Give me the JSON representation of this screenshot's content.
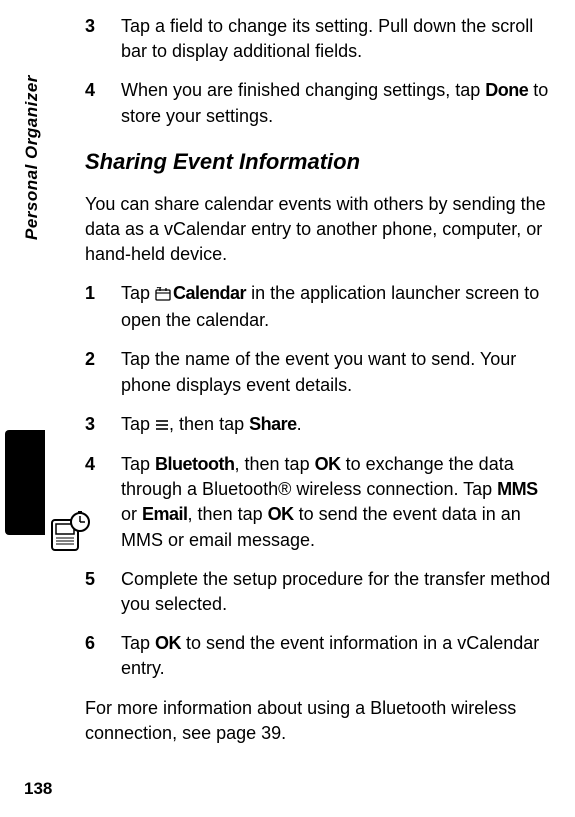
{
  "sidebar": {
    "label": "Personal Organizer"
  },
  "top_steps": [
    {
      "num": "3",
      "parts": [
        {
          "t": "Tap a field to change its setting. Pull down the scroll bar to display additional fields."
        }
      ]
    },
    {
      "num": "4",
      "parts": [
        {
          "t": "When you are finished changing settings, tap "
        },
        {
          "ui": "Done"
        },
        {
          "t": " to store your settings."
        }
      ]
    }
  ],
  "section_heading": "Sharing Event Information",
  "intro": "You can share calendar events with others by sending the data as a vCalendar entry to another phone, computer, or hand-held device.",
  "main_steps": [
    {
      "num": "1",
      "parts": [
        {
          "t": "Tap "
        },
        {
          "calicon": true
        },
        {
          "ui": "Calendar"
        },
        {
          "t": " in the application launcher screen to open the calendar."
        }
      ]
    },
    {
      "num": "2",
      "parts": [
        {
          "t": "Tap the name of the event you want to send. Your phone displays event details."
        }
      ]
    },
    {
      "num": "3",
      "parts": [
        {
          "t": "Tap "
        },
        {
          "menuicon": true
        },
        {
          "t": ", then tap "
        },
        {
          "ui": "Share"
        },
        {
          "t": "."
        }
      ]
    },
    {
      "num": "4",
      "parts": [
        {
          "t": "Tap "
        },
        {
          "ui": "Bluetooth"
        },
        {
          "t": ", then tap "
        },
        {
          "ui": "OK"
        },
        {
          "t": " to exchange the data through a Bluetooth® wireless connection. Tap "
        },
        {
          "ui": "MMS"
        },
        {
          "t": " or "
        },
        {
          "ui": "Email"
        },
        {
          "t": ", then tap "
        },
        {
          "ui": "OK"
        },
        {
          "t": " to send the event data in an MMS or email message."
        }
      ]
    },
    {
      "num": "5",
      "parts": [
        {
          "t": "Complete the setup procedure for the transfer method you selected."
        }
      ]
    },
    {
      "num": "6",
      "parts": [
        {
          "t": "Tap "
        },
        {
          "ui": "OK"
        },
        {
          "t": " to send the event information in a vCalendar entry."
        }
      ]
    }
  ],
  "outro": "For more information about using a Bluetooth wireless connection, see page 39.",
  "page_number": "138"
}
